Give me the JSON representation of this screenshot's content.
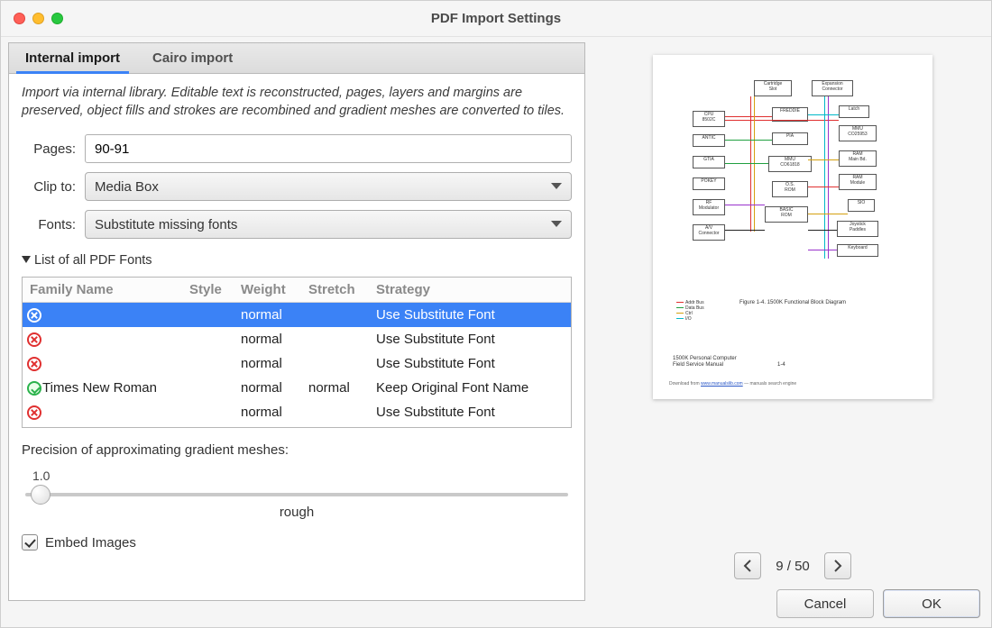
{
  "window": {
    "title": "PDF Import Settings"
  },
  "tabs": [
    {
      "label": "Internal import",
      "active": true
    },
    {
      "label": "Cairo import",
      "active": false
    }
  ],
  "description": "Import via internal library. Editable text is reconstructed, pages, layers and margins are preserved, object fills and strokes are recombined and gradient meshes are converted to tiles.",
  "form": {
    "pages_label": "Pages:",
    "pages_value": "90-91",
    "clip_label": "Clip to:",
    "clip_value": "Media Box",
    "fonts_label": "Fonts:",
    "fonts_value": "Substitute missing fonts"
  },
  "font_list": {
    "disclosure_label": "List of all PDF Fonts",
    "columns": [
      "Family Name",
      "Style",
      "Weight",
      "Stretch",
      "Strategy"
    ],
    "rows": [
      {
        "ok": false,
        "family": "",
        "style": "",
        "weight": "normal",
        "stretch": "",
        "strategy": "Use Substitute Font",
        "selected": true
      },
      {
        "ok": false,
        "family": "",
        "style": "",
        "weight": "normal",
        "stretch": "",
        "strategy": "Use Substitute Font",
        "selected": false
      },
      {
        "ok": false,
        "family": "",
        "style": "",
        "weight": "normal",
        "stretch": "",
        "strategy": "Use Substitute Font",
        "selected": false
      },
      {
        "ok": true,
        "family": "Times New Roman",
        "style": "",
        "weight": "normal",
        "stretch": "normal",
        "strategy": "Keep Original Font Name",
        "selected": false
      },
      {
        "ok": false,
        "family": "",
        "style": "",
        "weight": "normal",
        "stretch": "",
        "strategy": "Use Substitute Font",
        "selected": false
      }
    ]
  },
  "precision": {
    "label": "Precision of approximating gradient meshes:",
    "value_text": "1.0",
    "caption": "rough"
  },
  "embed_images": {
    "label": "Embed Images",
    "checked": true
  },
  "pager": {
    "current": 9,
    "total": 50,
    "text": "9 / 50"
  },
  "buttons": {
    "cancel": "Cancel",
    "ok": "OK"
  },
  "preview": {
    "caption": "Figure 1-4. 1500K Functional Block Diagram",
    "footer_line1": "1500K Personal Computer",
    "footer_line2": "Field Service Manual",
    "footer_page": "1-4"
  }
}
